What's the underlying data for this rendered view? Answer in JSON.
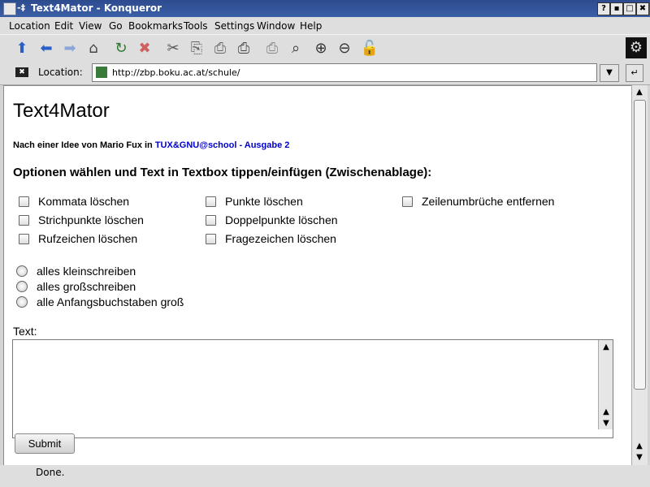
{
  "window": {
    "title": "Text4Mator - Konqueror",
    "pin_glyph": "-‡",
    "controls": [
      "?",
      "▪",
      "□",
      "✖"
    ]
  },
  "menubar": {
    "items": [
      "Location",
      "Edit",
      "View",
      "Go",
      "Bookmarks",
      "Tools",
      "Settings",
      "Window",
      "Help"
    ]
  },
  "toolbar": {
    "icons": [
      "up-icon",
      "back-icon",
      "forward-icon",
      "home-icon",
      "reload-icon",
      "stop-icon",
      "cut-icon",
      "copy-icon",
      "paste-icon",
      "print-icon",
      "print-frame-icon",
      "find-icon",
      "zoom-in-icon",
      "zoom-out-icon",
      "security-lock-icon"
    ],
    "glyphs": [
      "⬆",
      "⬅",
      "➡",
      "⌂",
      "↻",
      "✖",
      "✂",
      "⎘",
      "⎙",
      "⎙",
      "⎙",
      "⌕",
      "⊕",
      "⊖",
      "🔓"
    ]
  },
  "location": {
    "label": "Location:",
    "url": "http://zbp.boku.ac.at/schule/"
  },
  "page": {
    "heading": "Text4Mator",
    "credit_prefix": "Nach einer Idee von Mario Fux in ",
    "credit_link": "TUX&GNU@school - Ausgabe 2",
    "options_heading": "Optionen wählen und Text in Textbox tippen/einfügen (Zwischenablage):",
    "checkboxes": [
      "Kommata löschen",
      "Strichpunkte löschen",
      "Rufzeichen löschen",
      "Punkte löschen",
      "Doppelpunkte löschen",
      "Fragezeichen löschen",
      "Zeilenumbrüche entfernen"
    ],
    "radios": [
      "alles kleinschreiben",
      "alles großschreiben",
      "alle Anfangsbuchstaben groß"
    ],
    "text_label": "Text:",
    "text_value": "",
    "submit_label": "Submit"
  },
  "status": {
    "text": "Done."
  }
}
